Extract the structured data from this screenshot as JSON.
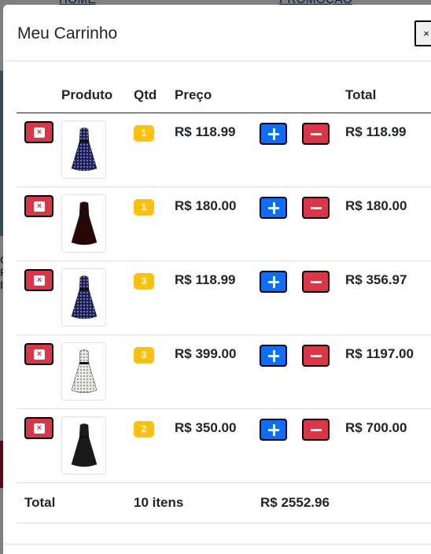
{
  "background": {
    "nav_items": [
      "HOME",
      "PROMOÇÃO"
    ],
    "side_text": "C R I"
  },
  "modal": {
    "title": "Meu Carrinho",
    "close_label": "×"
  },
  "table": {
    "headers": {
      "product": "Produto",
      "qty": "Qtd",
      "price": "Preço",
      "total": "Total"
    },
    "rows": [
      {
        "qty": "1",
        "price": "R$ 118.99",
        "total": "R$ 118.99",
        "dress_color": "#1b1f5e",
        "dots": true
      },
      {
        "qty": "1",
        "price": "R$ 180.00",
        "total": "R$ 180.00",
        "dress_color": "#2a0707",
        "dots": false
      },
      {
        "qty": "3",
        "price": "R$ 118.99",
        "total": "R$ 356.97",
        "dress_color": "#1b1f5e",
        "dots": true
      },
      {
        "qty": "3",
        "price": "R$ 399.00",
        "total": "R$ 1197.00",
        "dress_color": "#e9e9e4",
        "dots": true
      },
      {
        "qty": "2",
        "price": "R$ 350.00",
        "total": "R$ 700.00",
        "dress_color": "#1a1a1a",
        "dots": false
      }
    ],
    "footer": {
      "label": "Total",
      "items": "10 itens",
      "grand_total": "R$ 2552.96"
    }
  },
  "icons": {
    "delete": "delete-x-icon",
    "increase": "plus-icon",
    "decrease": "minus-icon"
  },
  "colors": {
    "danger": "#dc3545",
    "primary": "#0d6efd",
    "warning": "#ffc107"
  }
}
